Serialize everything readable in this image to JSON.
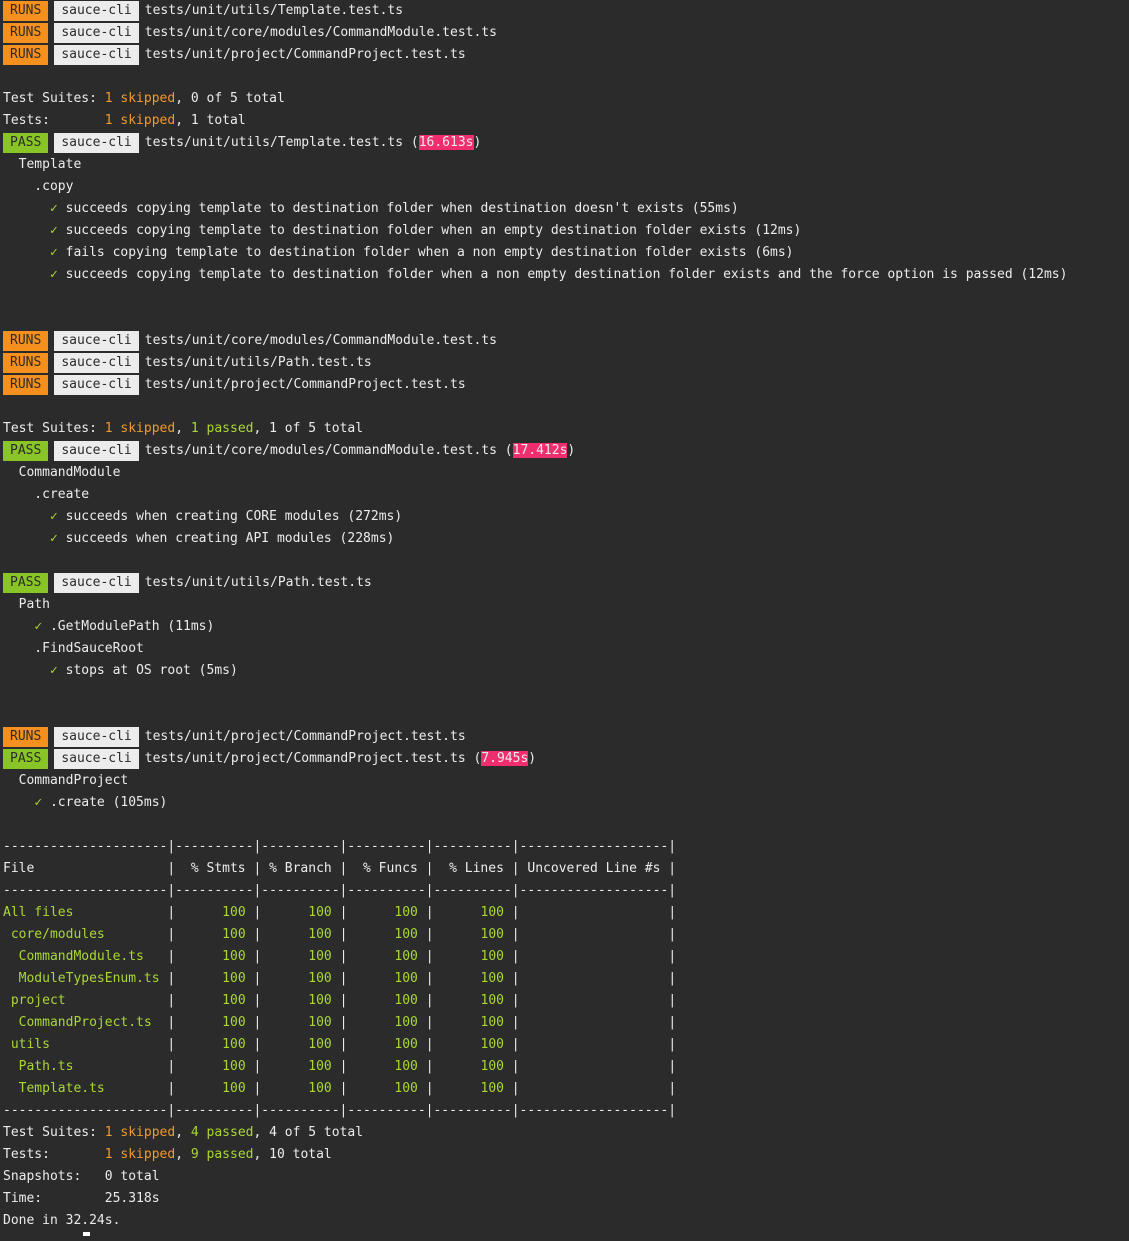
{
  "colors": {
    "background": "#2b2b2b",
    "runs_badge": "#f5901f",
    "pass_badge": "#8ac527",
    "project_badge": "#ececec",
    "slow_time": "#f02d6e",
    "skipped": "#ef9a2f",
    "passed": "#a9d734"
  },
  "lines": [
    {
      "type": "status",
      "status": "RUNS",
      "project": "sauce-cli",
      "path": "tests/unit/utils/Template.test.ts"
    },
    {
      "type": "status",
      "status": "RUNS",
      "project": "sauce-cli",
      "path": "tests/unit/core/modules/CommandModule.test.ts"
    },
    {
      "type": "status",
      "status": "RUNS",
      "project": "sauce-cli",
      "path": "tests/unit/project/CommandProject.test.ts"
    },
    {
      "type": "blank"
    },
    {
      "type": "summary",
      "label": "Test Suites: ",
      "skipped": "1 skipped",
      "passed": "",
      "total": "0 of 5 total"
    },
    {
      "type": "summary",
      "label": "Tests:       ",
      "skipped": "1 skipped",
      "passed": "",
      "total": "1 total"
    },
    {
      "type": "status",
      "status": "PASS",
      "project": "sauce-cli",
      "path": "tests/unit/utils/Template.test.ts",
      "time": "16.613s"
    },
    {
      "type": "text",
      "text": "  Template"
    },
    {
      "type": "text",
      "text": "    .copy"
    },
    {
      "type": "test",
      "indent": "      ",
      "check": "✓",
      "text": "succeeds copying template to destination folder when destination doesn't exists (55ms)"
    },
    {
      "type": "test",
      "indent": "      ",
      "check": "✓",
      "text": "succeeds copying template to destination folder when an empty destination folder exists (12ms)"
    },
    {
      "type": "test",
      "indent": "      ",
      "check": "✓",
      "text": "fails copying template to destination folder when a non empty destination folder exists (6ms)"
    },
    {
      "type": "test",
      "indent": "      ",
      "check": "✓",
      "text": "succeeds copying template to destination folder when a non empty destination folder exists and the force option is passed (12ms)"
    },
    {
      "type": "blank"
    },
    {
      "type": "blank"
    },
    {
      "type": "status",
      "status": "RUNS",
      "project": "sauce-cli",
      "path": "tests/unit/core/modules/CommandModule.test.ts"
    },
    {
      "type": "status",
      "status": "RUNS",
      "project": "sauce-cli",
      "path": "tests/unit/utils/Path.test.ts"
    },
    {
      "type": "status",
      "status": "RUNS",
      "project": "sauce-cli",
      "path": "tests/unit/project/CommandProject.test.ts"
    },
    {
      "type": "blank"
    },
    {
      "type": "summary",
      "label": "Test Suites: ",
      "skipped": "1 skipped",
      "passed": "1 passed",
      "total": "1 of 5 total"
    },
    {
      "type": "status",
      "status": "PASS",
      "project": "sauce-cli",
      "path": "tests/unit/core/modules/CommandModule.test.ts",
      "time": "17.412s"
    },
    {
      "type": "text",
      "text": "  CommandModule"
    },
    {
      "type": "text",
      "text": "    .create"
    },
    {
      "type": "test",
      "indent": "      ",
      "check": "✓",
      "text": "succeeds when creating CORE modules (272ms)"
    },
    {
      "type": "test",
      "indent": "      ",
      "check": "✓",
      "text": "succeeds when creating API modules (228ms)"
    },
    {
      "type": "blank"
    },
    {
      "type": "status",
      "status": "PASS",
      "project": "sauce-cli",
      "path": "tests/unit/utils/Path.test.ts"
    },
    {
      "type": "text",
      "text": "  Path"
    },
    {
      "type": "test",
      "indent": "    ",
      "check": "✓",
      "text": ".GetModulePath (11ms)"
    },
    {
      "type": "text",
      "text": "    .FindSauceRoot"
    },
    {
      "type": "test",
      "indent": "      ",
      "check": "✓",
      "text": "stops at OS root (5ms)"
    },
    {
      "type": "blank"
    },
    {
      "type": "blank"
    },
    {
      "type": "status",
      "status": "RUNS",
      "project": "sauce-cli",
      "path": "tests/unit/project/CommandProject.test.ts"
    },
    {
      "type": "status",
      "status": "PASS",
      "project": "sauce-cli",
      "path": "tests/unit/project/CommandProject.test.ts",
      "time": "7.945s"
    },
    {
      "type": "text",
      "text": "  CommandProject"
    },
    {
      "type": "test",
      "indent": "    ",
      "check": "✓",
      "text": ".create (105ms)"
    },
    {
      "type": "blank"
    },
    {
      "type": "sep",
      "text": "---------------------|----------|----------|----------|----------|-------------------|"
    },
    {
      "type": "cov_header",
      "text": "File                 |  % Stmts | % Branch |  % Funcs |  % Lines | Uncovered Line #s |"
    },
    {
      "type": "sep",
      "text": "---------------------|----------|----------|----------|----------|-------------------|"
    },
    {
      "type": "cov",
      "file": "All files",
      "indent": "",
      "stmts": "100",
      "branch": "100",
      "funcs": "100",
      "lines": "100",
      "uncovered": ""
    },
    {
      "type": "cov",
      "file": "core/modules",
      "indent": " ",
      "stmts": "100",
      "branch": "100",
      "funcs": "100",
      "lines": "100",
      "uncovered": ""
    },
    {
      "type": "cov",
      "file": "CommandModule.ts",
      "indent": "  ",
      "stmts": "100",
      "branch": "100",
      "funcs": "100",
      "lines": "100",
      "uncovered": ""
    },
    {
      "type": "cov",
      "file": "ModuleTypesEnum.ts",
      "indent": "  ",
      "stmts": "100",
      "branch": "100",
      "funcs": "100",
      "lines": "100",
      "uncovered": ""
    },
    {
      "type": "cov",
      "file": "project",
      "indent": " ",
      "stmts": "100",
      "branch": "100",
      "funcs": "100",
      "lines": "100",
      "uncovered": ""
    },
    {
      "type": "cov",
      "file": "CommandProject.ts",
      "indent": "  ",
      "stmts": "100",
      "branch": "100",
      "funcs": "100",
      "lines": "100",
      "uncovered": ""
    },
    {
      "type": "cov",
      "file": "utils",
      "indent": " ",
      "stmts": "100",
      "branch": "100",
      "funcs": "100",
      "lines": "100",
      "uncovered": ""
    },
    {
      "type": "cov",
      "file": "Path.ts",
      "indent": "  ",
      "stmts": "100",
      "branch": "100",
      "funcs": "100",
      "lines": "100",
      "uncovered": ""
    },
    {
      "type": "cov",
      "file": "Template.ts",
      "indent": "  ",
      "stmts": "100",
      "branch": "100",
      "funcs": "100",
      "lines": "100",
      "uncovered": ""
    },
    {
      "type": "sep",
      "text": "---------------------|----------|----------|----------|----------|-------------------|"
    },
    {
      "type": "summary",
      "label": "Test Suites: ",
      "skipped": "1 skipped",
      "passed": "4 passed",
      "total": "4 of 5 total"
    },
    {
      "type": "summary",
      "label": "Tests:       ",
      "skipped": "1 skipped",
      "passed": "9 passed",
      "total": "10 total"
    },
    {
      "type": "text",
      "text": "Snapshots:   0 total"
    },
    {
      "type": "text",
      "text": "Time:        25.318s"
    },
    {
      "type": "text",
      "text": "Done in 32.24s.",
      "cursor": true
    }
  ]
}
